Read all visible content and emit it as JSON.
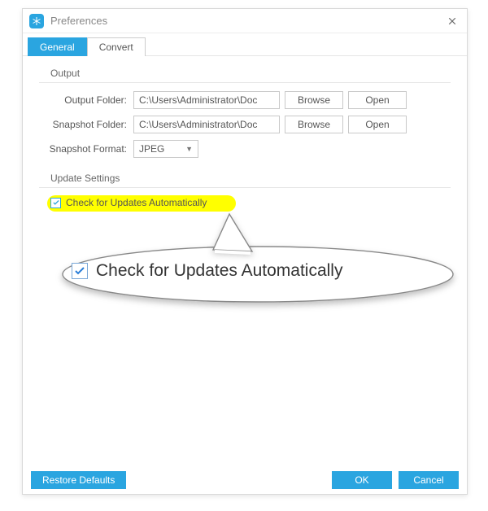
{
  "window": {
    "title": "Preferences"
  },
  "tabs": {
    "general": "General",
    "convert": "Convert"
  },
  "output": {
    "group_title": "Output",
    "output_folder_label": "Output Folder:",
    "output_folder_value": "C:\\Users\\Administrator\\Doc",
    "snapshot_folder_label": "Snapshot Folder:",
    "snapshot_folder_value": "C:\\Users\\Administrator\\Doc",
    "snapshot_format_label": "Snapshot Format:",
    "snapshot_format_value": "JPEG",
    "browse": "Browse",
    "open": "Open"
  },
  "update": {
    "group_title": "Update Settings",
    "checkbox_label": "Check for Updates Automatically"
  },
  "callout": {
    "text": "Check for Updates Automatically"
  },
  "footer": {
    "restore": "Restore Defaults",
    "ok": "OK",
    "cancel": "Cancel"
  }
}
